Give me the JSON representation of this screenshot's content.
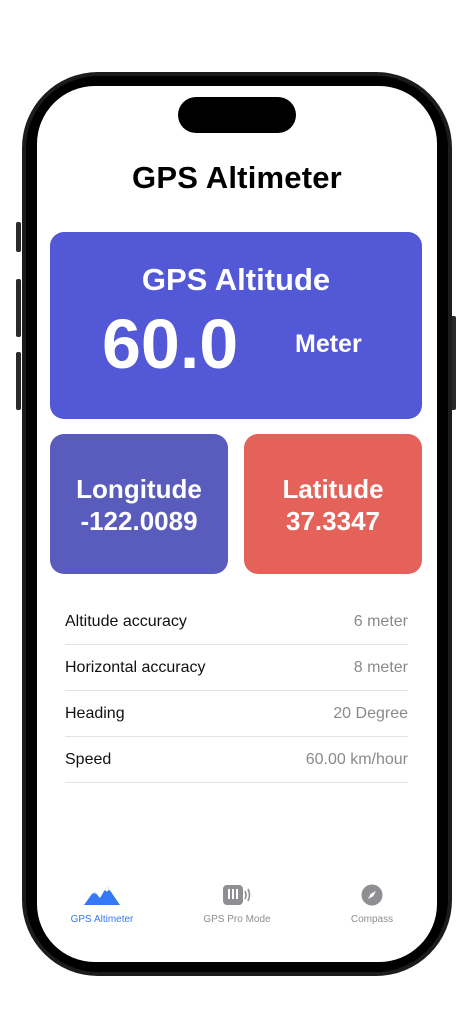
{
  "app": {
    "title": "GPS Altimeter"
  },
  "altitude_card": {
    "label": "GPS Altitude",
    "value": "60.0",
    "unit": "Meter",
    "color": "#5258d6"
  },
  "longitude_card": {
    "label": "Longitude",
    "value": "-122.0089",
    "color": "#5a5cbd"
  },
  "latitude_card": {
    "label": "Latitude",
    "value": "37.3347",
    "color": "#e5625a"
  },
  "details": [
    {
      "label": "Altitude accuracy",
      "value": "6 meter"
    },
    {
      "label": "Horizontal accuracy",
      "value": "8 meter"
    },
    {
      "label": "Heading",
      "value": "20 Degree"
    },
    {
      "label": "Speed",
      "value": "60.00 km/hour"
    }
  ],
  "tabs": [
    {
      "label": "GPS Altimeter",
      "icon": "mountains-icon",
      "active": true
    },
    {
      "label": "GPS Pro Mode",
      "icon": "signal-icon",
      "active": false
    },
    {
      "label": "Compass",
      "icon": "compass-icon",
      "active": false
    }
  ],
  "colors": {
    "tab_active": "#3478f6",
    "tab_inactive": "#8e8e93"
  }
}
